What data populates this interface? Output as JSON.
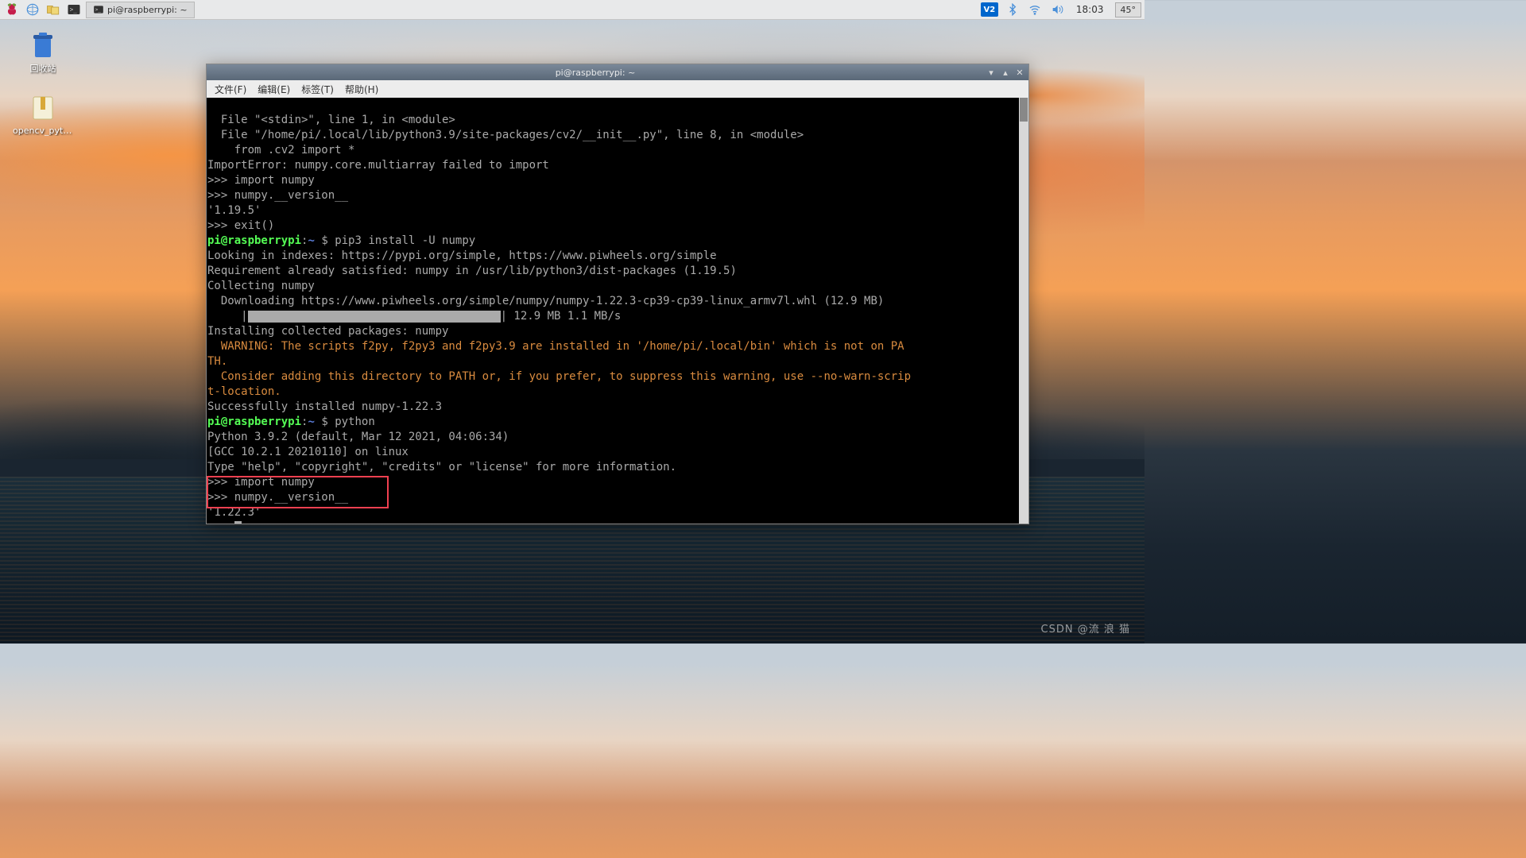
{
  "taskbar": {
    "task_label": "pi@raspberrypi: ~",
    "clock": "18:03",
    "temp": "45°",
    "vnc": "V2"
  },
  "desktop": {
    "trash_label": "回收站",
    "opencv_label": "opencv_python..."
  },
  "window": {
    "title": "pi@raspberrypi: ~",
    "menu": {
      "file": "文件(F)",
      "edit": "编辑(E)",
      "tabs": "标签(T)",
      "help": "帮助(H)"
    }
  },
  "term": {
    "l1": "  File \"<stdin>\", line 1, in <module>",
    "l2": "  File \"/home/pi/.local/lib/python3.9/site-packages/cv2/__init__.py\", line 8, in <module>",
    "l3": "    from .cv2 import *",
    "l4": "ImportError: numpy.core.multiarray failed to import",
    "l5": ">>> import numpy",
    "l6": ">>> numpy.__version__",
    "l7": "'1.19.5'",
    "l8": ">>> exit()",
    "p1_user": "pi@raspberrypi",
    "p1_sep": ":",
    "p1_path": "~",
    "p1_dollar": " $ ",
    "p1_cmd": "pip3 install -U numpy",
    "l10": "Looking in indexes: https://pypi.org/simple, https://www.piwheels.org/simple",
    "l11": "Requirement already satisfied: numpy in /usr/lib/python3/dist-packages (1.19.5)",
    "l12": "Collecting numpy",
    "l13": "  Downloading https://www.piwheels.org/simple/numpy/numpy-1.22.3-cp39-cp39-linux_armv7l.whl (12.9 MB)",
    "l14a": "     |",
    "l14b": "| 12.9 MB 1.1 MB/s",
    "l15": "Installing collected packages: numpy",
    "w1": "  WARNING: The scripts f2py, f2py3 and f2py3.9 are installed in '/home/pi/.local/bin' which is not on PA",
    "w1b": "TH.",
    "w2": "  Consider adding this directory to PATH or, if you prefer, to suppress this warning, use --no-warn-scrip",
    "w2b": "t-location.",
    "l18": "Successfully installed numpy-1.22.3",
    "p2_cmd": "python",
    "l20": "Python 3.9.2 (default, Mar 12 2021, 04:06:34)",
    "l21": "[GCC 10.2.1 20210110] on linux",
    "l22": "Type \"help\", \"copyright\", \"credits\" or \"license\" for more information.",
    "l23": ">>> import numpy",
    "l24": ">>> numpy.__version__",
    "l25": "'1.22.3'",
    "l26": ">>> "
  },
  "watermark": "CSDN @流 浪 猫"
}
